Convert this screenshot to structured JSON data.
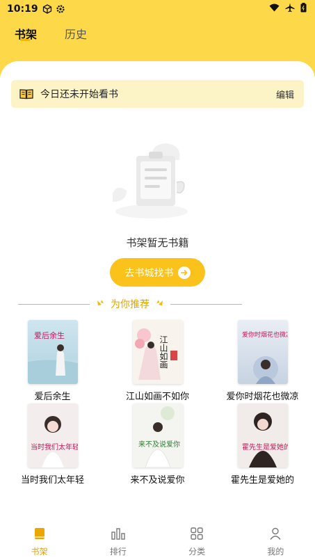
{
  "status": {
    "time": "10:19"
  },
  "tabs": [
    {
      "label": "书架"
    },
    {
      "label": "历史"
    }
  ],
  "notice": {
    "text": "今日还未开始看书",
    "edit_label": "编辑"
  },
  "empty": {
    "message": "书架暂无书籍",
    "button_label": "去书城找书"
  },
  "recommend": {
    "title": "为你推荐",
    "books": [
      {
        "title": "爱后余生",
        "cover_text": "爱后余生"
      },
      {
        "title": "江山如画不如你",
        "cover_text": "江山如画"
      },
      {
        "title": "爱你时烟花也微凉",
        "cover_text": "爱你时烟花也微凉"
      },
      {
        "title": "当时我们太年轻",
        "cover_text": "当时我们太年轻"
      },
      {
        "title": "来不及说爱你",
        "cover_text": "来不及说爱你"
      },
      {
        "title": "霍先生是爱她的",
        "cover_text": "霍先生是爱她的"
      }
    ]
  },
  "nav": [
    {
      "label": "书架",
      "icon": "bookshelf-icon"
    },
    {
      "label": "排行",
      "icon": "ranking-icon"
    },
    {
      "label": "分类",
      "icon": "category-icon"
    },
    {
      "label": "我的",
      "icon": "profile-icon"
    }
  ],
  "colors": {
    "accent": "#FDD94A",
    "button": "#FBC21C",
    "active": "#E1A500"
  }
}
